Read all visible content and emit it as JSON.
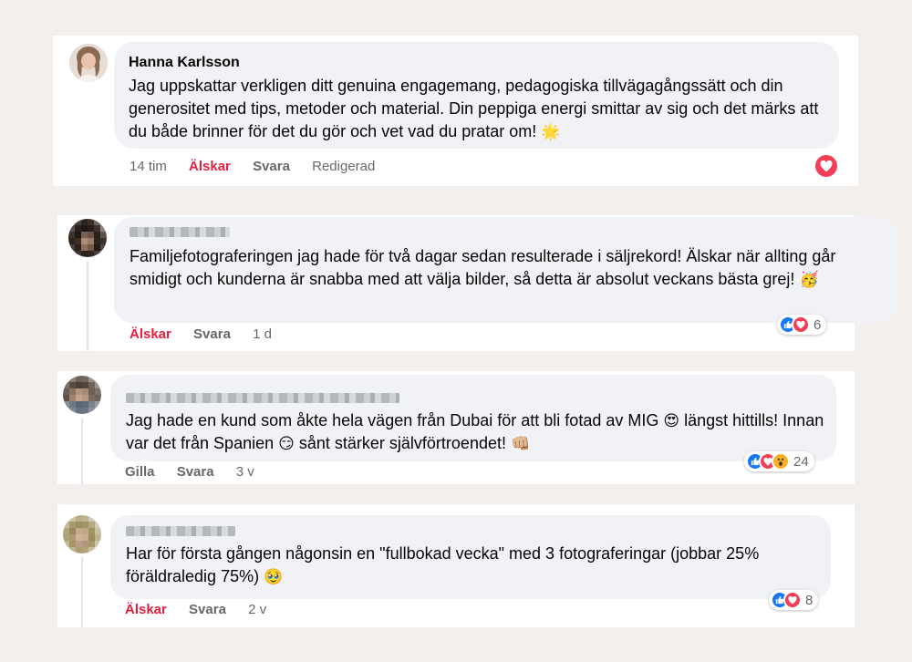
{
  "colors": {
    "page_bg": "#f2efec",
    "bubble_bg": "#f0f2f5",
    "love": "#e41e3f",
    "like": "#1877f2",
    "heart": "#f33e58",
    "wow": "#f7b125",
    "muted": "#65676b"
  },
  "comments": [
    {
      "author": "Hanna Karlsson",
      "author_visible": true,
      "text": "Jag uppskattar verkligen ditt genuina engagemang, pedagogiska tillvägagångssätt och din generositet med tips, metoder och material. Din peppiga energi smittar av sig och det märks att du både brinner för det du gör och vet vad du pratar om!",
      "emoji": "🌟",
      "meta": {
        "time": "14 tim",
        "react": "Älskar",
        "reply": "Svara",
        "extra": "Redigerad"
      },
      "reaction_icons": [
        "heart-icon"
      ]
    },
    {
      "author_visible": false,
      "text": "Familjefotograferingen jag hade för två dagar sedan resulterade i säljrekord! Älskar när allting går smidigt och kunderna är snabba med att välja bilder, så detta är absolut veckans bästa grej!",
      "emoji": "🥳",
      "meta": {
        "react": "Älskar",
        "reply": "Svara",
        "time": "1 d"
      },
      "reaction_icons": [
        "like-icon",
        "heart-icon"
      ],
      "reaction_count": "6"
    },
    {
      "author_visible": false,
      "text_a": "Jag hade en kund som åkte hela vägen från Dubai för att bli fotad av MIG",
      "emoji_a": "😍",
      "text_b": "längst hittills! Innan var det från Spanien",
      "emoji_b": "😏",
      "text_c": "sånt stärker självförtroendet!",
      "emoji_c": "👊🏼",
      "meta": {
        "react": "Gilla",
        "reply": "Svara",
        "time": "3 v"
      },
      "reaction_icons": [
        "like-icon",
        "heart-icon",
        "wow-icon"
      ],
      "reaction_count": "24"
    },
    {
      "author_visible": false,
      "text": "Har för första gången någonsin en \"fullbokad vecka\" med 3 fotograferingar (jobbar 25% föräldraledig 75%)",
      "emoji": "🥹",
      "meta": {
        "react": "Älskar",
        "reply": "Svara",
        "time": "2 v"
      },
      "reaction_icons": [
        "like-icon",
        "heart-icon"
      ],
      "reaction_count": "8"
    }
  ]
}
